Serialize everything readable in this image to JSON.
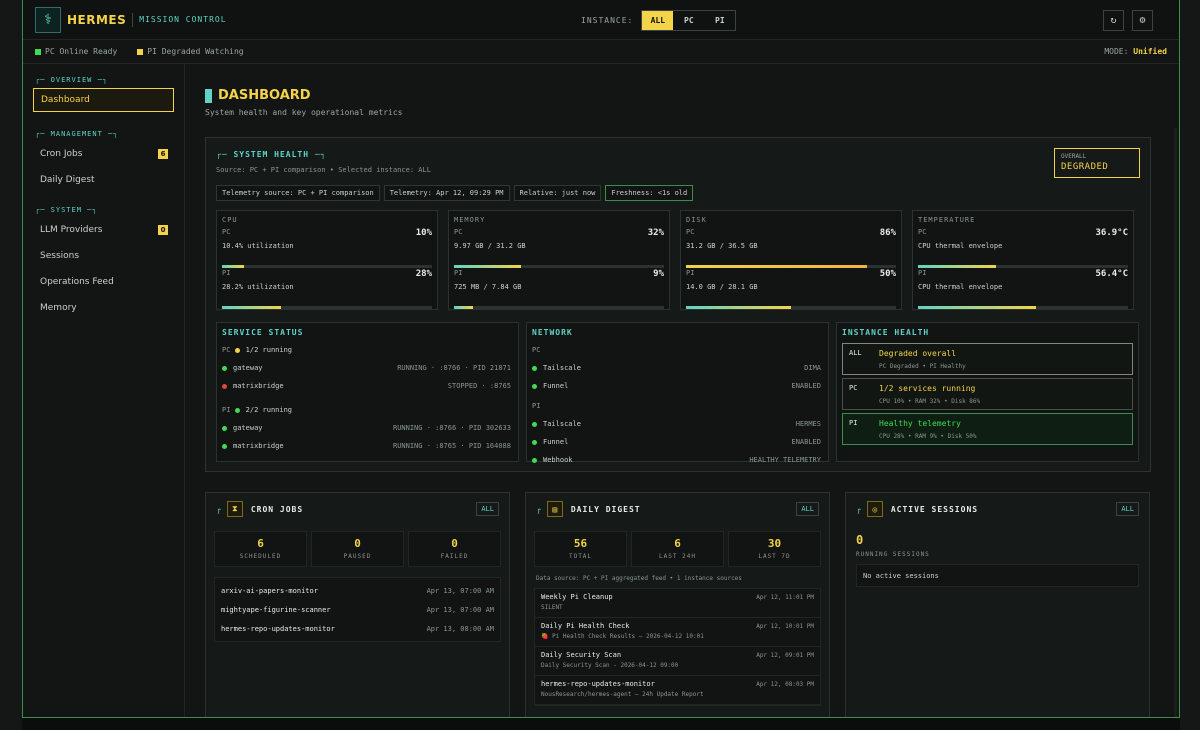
{
  "app": {
    "brand": "HERMES",
    "subtitle": "MISSION CONTROL"
  },
  "header": {
    "instance_label": "INSTANCE:",
    "instance_options": [
      "ALL",
      "PC",
      "PI"
    ],
    "instance_selected": "ALL",
    "refresh_icon": "↻",
    "settings_icon": "⚙"
  },
  "status_bar": {
    "pc": {
      "name": "PC",
      "text": "Online Ready",
      "color": "#3ddc53"
    },
    "pi": {
      "name": "PI",
      "text": "Degraded Watching",
      "color": "#f3d34a"
    },
    "mode_label": "MODE:",
    "mode_value": "Unified"
  },
  "sidebar": {
    "overview_label": "OVERVIEW",
    "management_label": "MANAGEMENT",
    "system_label": "SYSTEM",
    "items": {
      "dashboard": "Dashboard",
      "cron_jobs": "Cron Jobs",
      "cron_badge": "6",
      "daily_digest": "Daily Digest",
      "llm_providers": "LLM Providers",
      "llm_badge": "0",
      "sessions": "Sessions",
      "operations_feed": "Operations Feed",
      "memory": "Memory"
    }
  },
  "page": {
    "title": "DASHBOARD",
    "subtitle": "System health and key operational metrics"
  },
  "system_health": {
    "title": "SYSTEM HEALTH",
    "source": "Source: PC + PI comparison • Selected instance: ALL",
    "overall_label": "OVERALL",
    "overall_value": "DEGRADED",
    "chips": [
      "Telemetry source: PC + PI comparison",
      "Telemetry: Apr 12, 09:29 PM",
      "Relative: just now",
      "Freshness: <1s old"
    ],
    "metrics": [
      {
        "title": "CPU",
        "pc": {
          "label": "PC",
          "value": "10%",
          "detail": "10.4% utilization",
          "level": 0.104
        },
        "pi": {
          "label": "PI",
          "value": "28%",
          "detail": "28.2% utilization",
          "level": 0.282
        }
      },
      {
        "title": "MEMORY",
        "pc": {
          "label": "PC",
          "value": "32%",
          "detail": "9.97 GB / 31.2 GB",
          "level": 0.32
        },
        "pi": {
          "label": "PI",
          "value": "9%",
          "detail": "725 MB / 7.84 GB",
          "level": 0.09
        }
      },
      {
        "title": "DISK",
        "pc": {
          "label": "PC",
          "value": "86%",
          "detail": "31.2 GB / 36.5 GB",
          "level": 0.86
        },
        "pi": {
          "label": "PI",
          "value": "50%",
          "detail": "14.0 GB / 28.1 GB",
          "level": 0.5
        }
      },
      {
        "title": "TEMPERATURE",
        "pc": {
          "label": "PC",
          "value": "36.9°C",
          "detail": "CPU thermal envelope",
          "level": 0.37
        },
        "pi": {
          "label": "PI",
          "value": "56.4°C",
          "detail": "CPU thermal envelope",
          "level": 0.56
        }
      }
    ]
  },
  "service_status": {
    "title": "SERVICE STATUS",
    "pc_label": "PC",
    "pc_summary": "1/2 running",
    "pc_rows": [
      {
        "name": "gateway",
        "status": "RUNNING · :8766 · PID 21871"
      },
      {
        "name": "matrixbridge",
        "status": "STOPPED · :8765"
      }
    ],
    "pi_label": "PI",
    "pi_summary": "2/2 running",
    "pi_rows": [
      {
        "name": "gateway",
        "status": "RUNNING · :8766 · PID 302633"
      },
      {
        "name": "matrixbridge",
        "status": "RUNNING · :8765 · PID 164088"
      }
    ]
  },
  "network": {
    "title": "NETWORK",
    "pc_label": "PC",
    "pc_rows": [
      {
        "name": "Tailscale",
        "status": "DIMA"
      },
      {
        "name": "Funnel",
        "status": "ENABLED"
      }
    ],
    "pi_label": "PI",
    "pi_rows": [
      {
        "name": "Tailscale",
        "status": "HERMES"
      },
      {
        "name": "Funnel",
        "status": "ENABLED"
      },
      {
        "name": "Webhook",
        "status": "HEALTHY TELEMETRY"
      }
    ]
  },
  "instance_health": {
    "title": "INSTANCE HEALTH",
    "rows": [
      {
        "tag": "ALL",
        "headline": "Degraded overall",
        "detail": "PC Degraded • PI Healthy"
      },
      {
        "tag": "PC",
        "headline": "1/2 services running",
        "detail": "CPU 10% • RAM 32% • Disk 86%"
      },
      {
        "tag": "PI",
        "headline": "Healthy telemetry",
        "detail": "CPU 28% • RAM 9% • Disk 50%"
      }
    ]
  },
  "cron_jobs": {
    "title": "CRON JOBS",
    "filter": "ALL",
    "icon": "⧗",
    "stats": [
      {
        "value": "6",
        "label": "SCHEDULED"
      },
      {
        "value": "0",
        "label": "PAUSED"
      },
      {
        "value": "0",
        "label": "FAILED"
      }
    ],
    "jobs": [
      {
        "name": "arxiv-ai-papers-monitor",
        "time": "Apr 13, 07:00 AM"
      },
      {
        "name": "mightyape-figurine-scanner",
        "time": "Apr 13, 07:00 AM"
      },
      {
        "name": "hermes-repo-updates-monitor",
        "time": "Apr 13, 08:00 AM"
      }
    ]
  },
  "daily_digest": {
    "title": "DAILY DIGEST",
    "filter": "ALL",
    "icon": "▤",
    "stats": [
      {
        "value": "56",
        "label": "TOTAL"
      },
      {
        "value": "6",
        "label": "LAST 24H"
      },
      {
        "value": "30",
        "label": "LAST 7D"
      }
    ],
    "source": "Data source: PC + PI aggregated feed • 1 instance sources",
    "entries": [
      {
        "title": "Weekly Pi Cleanup",
        "detail": "SILENT",
        "time": "Apr 12, 11:01 PM"
      },
      {
        "title": "Daily Pi Health Check",
        "detail": "🍓 Pi Health Check Results — 2026-04-12 10:01",
        "time": "Apr 12, 10:01 PM"
      },
      {
        "title": "Daily Security Scan",
        "detail": "Daily Security Scan - 2026-04-12 09:00",
        "time": "Apr 12, 09:01 PM"
      },
      {
        "title": "hermes-repo-updates-monitor",
        "detail": "NousResearch/hermes-agent — 24h Update Report",
        "time": "Apr 12, 08:03 PM"
      }
    ]
  },
  "active_sessions": {
    "title": "ACTIVE SESSIONS",
    "filter": "ALL",
    "icon": "◎",
    "count": "0",
    "count_label": "RUNNING SESSIONS",
    "empty": "No active sessions"
  }
}
